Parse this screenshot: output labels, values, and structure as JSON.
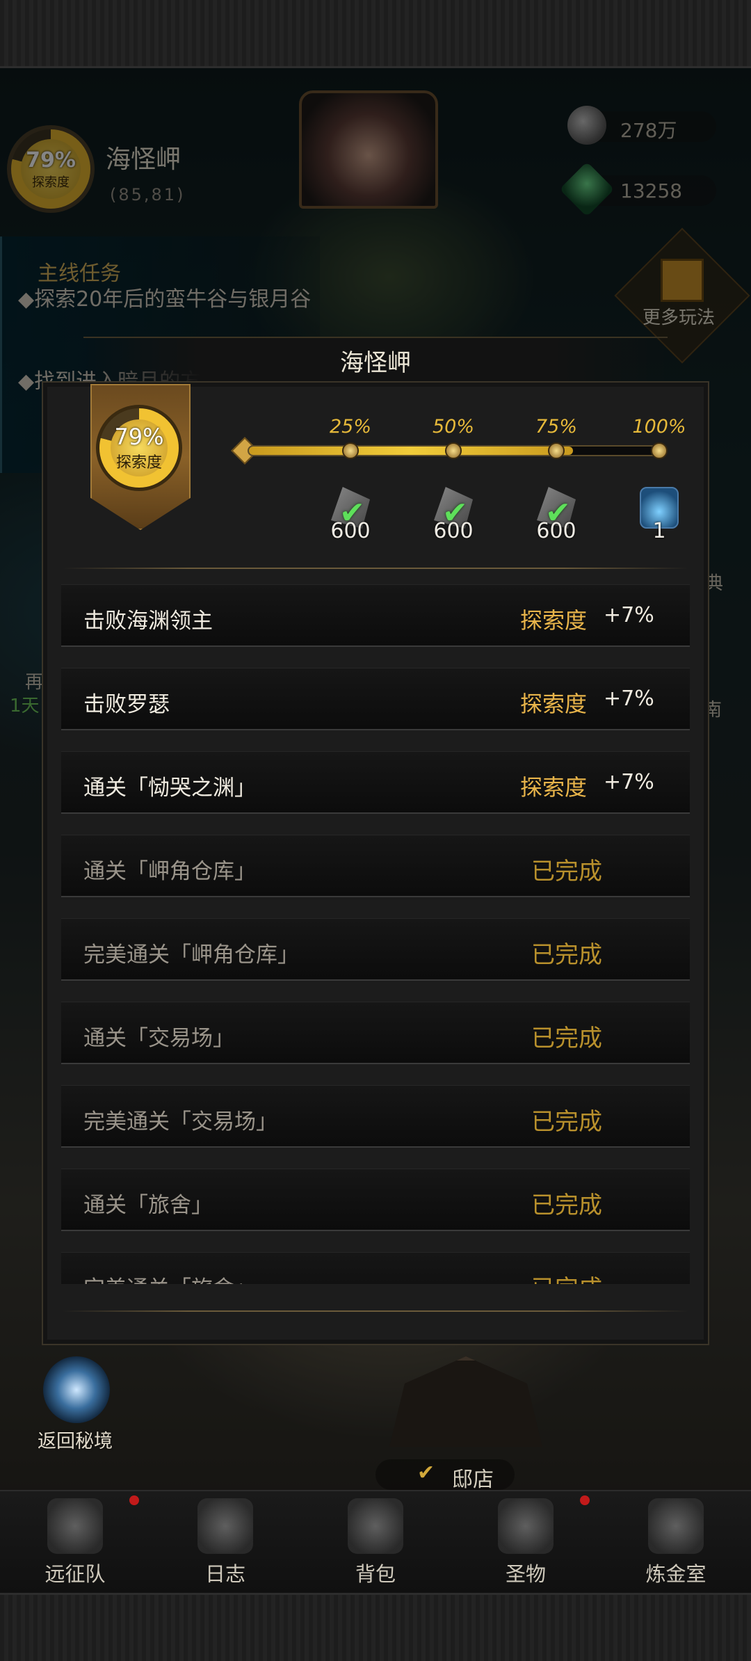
{
  "location": {
    "name": "海怪岬",
    "coords": "(85,81)",
    "exploration_percent": "79%",
    "exploration_label": "探索度"
  },
  "currencies": [
    {
      "icon": "silver-coin-icon",
      "value": "278万"
    },
    {
      "icon": "green-gem-icon",
      "value": "13258"
    }
  ],
  "quest": {
    "title": "主线任务",
    "items": [
      "探索20年后的蛮牛谷与银月谷",
      "找到进入暗月的方法"
    ]
  },
  "side": {
    "more_play_label": "更多玩法",
    "frag_left_1": "再",
    "frag_left_2": "1天",
    "frag_right_1": "典",
    "frag_right_2": "南"
  },
  "dialog": {
    "title": "海怪岬",
    "exploration_percent": "79%",
    "exploration_label": "探索度",
    "progress_fraction": 0.79,
    "milestones": [
      {
        "label": "25%",
        "reward_icon": "stone-material-icon",
        "reward_value": "600",
        "claimed": true
      },
      {
        "label": "50%",
        "reward_icon": "stone-material-icon",
        "reward_value": "600",
        "claimed": true
      },
      {
        "label": "75%",
        "reward_icon": "stone-material-icon",
        "reward_value": "600",
        "claimed": true
      },
      {
        "label": "100%",
        "reward_icon": "potion-bottle-icon",
        "reward_value": "1",
        "claimed": false
      }
    ],
    "tasks": [
      {
        "name": "击败海渊领主",
        "reward_label": "探索度",
        "reward_value": "+7%",
        "status": ""
      },
      {
        "name": "击败罗瑟",
        "reward_label": "探索度",
        "reward_value": "+7%",
        "status": ""
      },
      {
        "name": "通关「恸哭之渊」",
        "reward_label": "探索度",
        "reward_value": "+7%",
        "status": ""
      },
      {
        "name": "通关「岬角仓库」",
        "reward_label": "",
        "reward_value": "",
        "status": "已完成"
      },
      {
        "name": "完美通关「岬角仓库」",
        "reward_label": "",
        "reward_value": "",
        "status": "已完成"
      },
      {
        "name": "通关「交易场」",
        "reward_label": "",
        "reward_value": "",
        "status": "已完成"
      },
      {
        "name": "完美通关「交易场」",
        "reward_label": "",
        "reward_value": "",
        "status": "已完成"
      },
      {
        "name": "通关「旅舍」",
        "reward_label": "",
        "reward_value": "",
        "status": "已完成"
      },
      {
        "name": "完美通关「旅舍」",
        "reward_label": "",
        "reward_value": "",
        "status": "已完成"
      }
    ]
  },
  "map": {
    "return_label": "返回秘境",
    "shop_label": "邸店"
  },
  "nav": [
    {
      "label": "远征队",
      "icon": "viking-helmet-icon",
      "badge": true
    },
    {
      "label": "日志",
      "icon": "scroll-icon",
      "badge": false
    },
    {
      "label": "背包",
      "icon": "backpack-icon",
      "badge": false
    },
    {
      "label": "圣物",
      "icon": "relic-icon",
      "badge": true
    },
    {
      "label": "炼金室",
      "icon": "alchemy-icon",
      "badge": false
    }
  ],
  "colors": {
    "gold": "#e6b93a",
    "done": "#b8902c",
    "check": "#5ee05a",
    "badge": "#c21a1a"
  }
}
